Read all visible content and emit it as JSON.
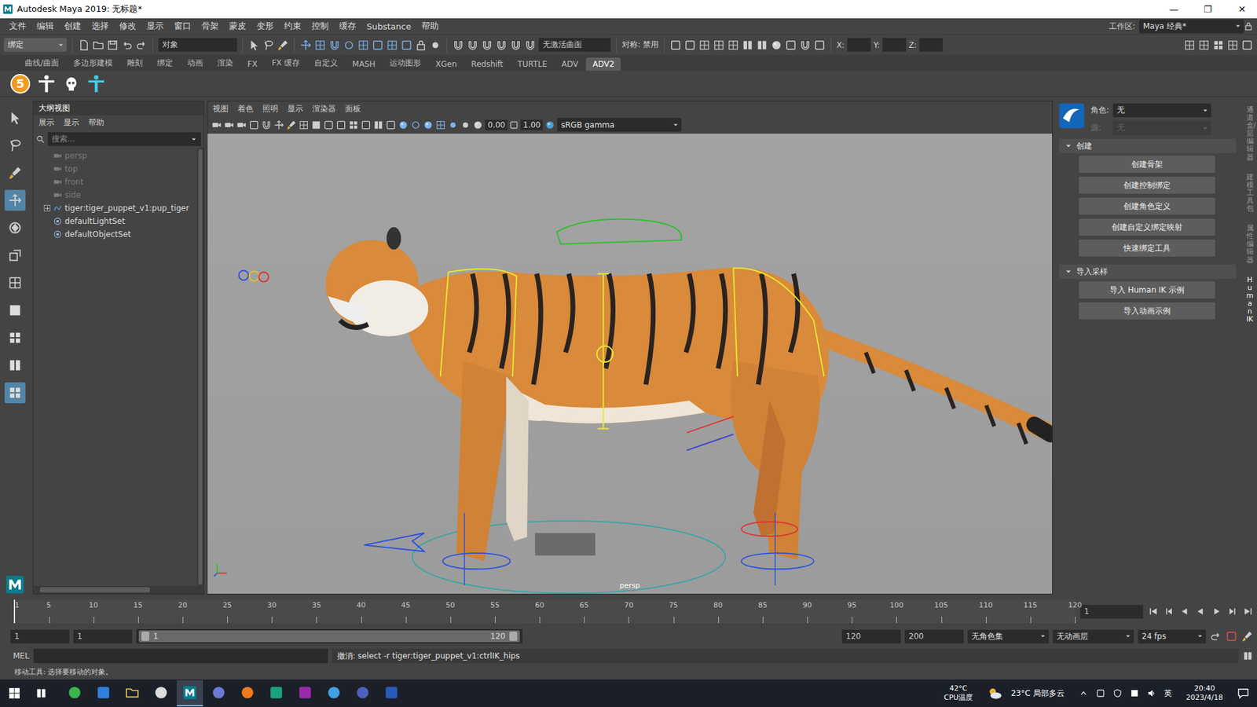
{
  "window": {
    "title": "Autodesk Maya 2019: 无标题*",
    "controls": [
      "—",
      "❐",
      "✕"
    ]
  },
  "menu_bar": {
    "items": [
      "文件",
      "编辑",
      "创建",
      "选择",
      "修改",
      "显示",
      "窗口",
      "骨架",
      "蒙皮",
      "变形",
      "约束",
      "控制",
      "缓存",
      "Substance",
      "帮助"
    ],
    "workspace_label": "工作区:",
    "workspace": "Maya 经典*"
  },
  "status_line": {
    "mode": "绑定",
    "selection_field": "对象",
    "live_surface": "无激活曲面",
    "symmetry": "对称: 禁用",
    "coords": [
      "X:",
      "Y:",
      "Z:"
    ]
  },
  "shelf": {
    "tabs": [
      {
        "label": "曲线/曲面",
        "selected": false
      },
      {
        "label": "多边形建模",
        "selected": false
      },
      {
        "label": "雕刻",
        "selected": false
      },
      {
        "label": "绑定",
        "selected": false
      },
      {
        "label": "动画",
        "selected": false
      },
      {
        "label": "渲染",
        "selected": false
      },
      {
        "label": "FX",
        "selected": false
      },
      {
        "label": "FX 缓存",
        "selected": false
      },
      {
        "label": "自定义",
        "selected": false
      },
      {
        "label": "MASH",
        "selected": false
      },
      {
        "label": "运动图形",
        "selected": false
      },
      {
        "label": "XGen",
        "selected": false
      },
      {
        "label": "Redshift",
        "selected": false
      },
      {
        "label": "TURTLE",
        "selected": false
      },
      {
        "label": "ADV",
        "selected": false
      },
      {
        "label": "ADV2",
        "selected": true
      }
    ],
    "badge": "5"
  },
  "outliner": {
    "title": "大纲视图",
    "menu": [
      "展示",
      "显示",
      "帮助"
    ],
    "search_placeholder": "搜索...",
    "items": [
      {
        "label": "persp",
        "kind": "camera",
        "dimmed": true,
        "expandable": false
      },
      {
        "label": "top",
        "kind": "camera",
        "dimmed": true,
        "expandable": false
      },
      {
        "label": "front",
        "kind": "camera",
        "dimmed": true,
        "expandable": false
      },
      {
        "label": "side",
        "kind": "camera",
        "dimmed": true,
        "expandable": false
      },
      {
        "label": "tiger:tiger_puppet_v1:pup_tiger",
        "kind": "group",
        "dimmed": false,
        "expandable": true
      },
      {
        "label": "defaultLightSet",
        "kind": "set",
        "dimmed": false,
        "expandable": false
      },
      {
        "label": "defaultObjectSet",
        "kind": "set",
        "dimmed": false,
        "expandable": false
      }
    ]
  },
  "viewport": {
    "menu": [
      "视图",
      "着色",
      "照明",
      "显示",
      "渲染器",
      "面板"
    ],
    "exposure": "0.00",
    "gamma": "1.00",
    "color_space": "sRGB gamma",
    "camera_label": "persp"
  },
  "human_ik": {
    "character_label": "角色:",
    "character": "无",
    "source_label": "源:",
    "source": "无",
    "source_disabled": true,
    "sections": [
      {
        "title": "创建",
        "expanded": true,
        "buttons": [
          "创建骨架",
          "创建控制绑定",
          "创建角色定义",
          "创建自定义绑定映射",
          "快速绑定工具"
        ]
      },
      {
        "title": "导入采样",
        "expanded": true,
        "buttons": [
          "导入 Human IK 示例",
          "导入动画示例"
        ]
      }
    ]
  },
  "side_tabs": [
    {
      "label": "通道盒/层编辑器",
      "selected": false
    },
    {
      "label": "建模工具包",
      "selected": false
    },
    {
      "label": "属性编辑器",
      "selected": false
    },
    {
      "label": "Human IK",
      "selected": true
    }
  ],
  "timeline": {
    "ticks": [
      "1",
      "5",
      "10",
      "15",
      "20",
      "25",
      "30",
      "35",
      "40",
      "45",
      "50",
      "55",
      "60",
      "65",
      "70",
      "75",
      "80",
      "85",
      "90",
      "95",
      "100",
      "105",
      "110",
      "115",
      "120"
    ],
    "current_frame": "1"
  },
  "range": {
    "start": "1",
    "playback_start": "1",
    "slider_start": "1",
    "slider_end": "120",
    "playback_end": "120",
    "end": "200",
    "character_set": "无角色集",
    "anim_layer": "无动画层",
    "fps": "24 fps"
  },
  "command_line": {
    "language": "MEL",
    "result": "撤消: select -r tiger:tiger_puppet_v1:ctrlIK_hips"
  },
  "help_line": "移动工具: 选择要移动的对象。",
  "taskbar": {
    "temperature": "42°C",
    "temperature_label": "CPU温度",
    "weather": "23°C 局部多云",
    "ime": "英",
    "time": "20:40",
    "date": "2023/4/18"
  }
}
